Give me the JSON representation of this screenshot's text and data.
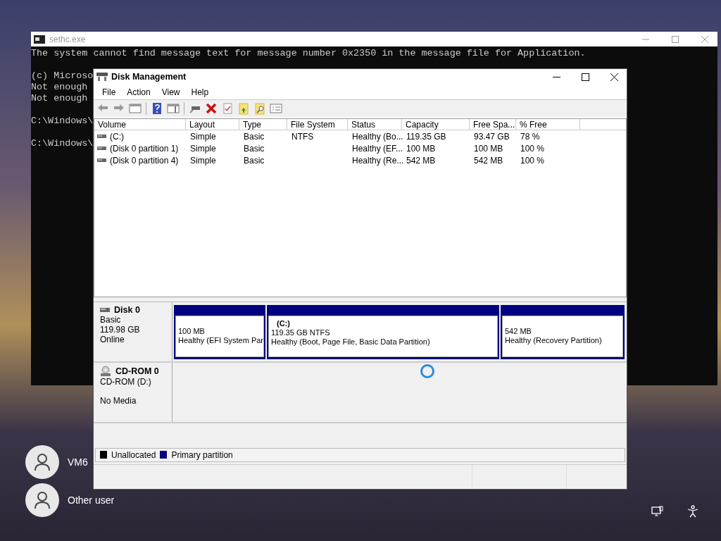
{
  "console": {
    "title": "sethc.exe",
    "paragraphs": [
      [
        "The system cannot find message text for message number 0x2350 in the message file for Application."
      ],
      [
        "(c) Microso",
        "Not enough",
        "Not enough"
      ],
      [
        "C:\\Windows\\"
      ],
      [
        "C:\\Windows\\"
      ]
    ]
  },
  "disk_management": {
    "title": "Disk Management",
    "menu": [
      "File",
      "Action",
      "View",
      "Help"
    ],
    "columns": [
      "Volume",
      "Layout",
      "Type",
      "File System",
      "Status",
      "Capacity",
      "Free Spa...",
      "% Free"
    ],
    "rows": [
      [
        "(C:)",
        "Simple",
        "Basic",
        "NTFS",
        "Healthy (Bo...",
        "119.35 GB",
        "93.47 GB",
        "78 %"
      ],
      [
        "(Disk 0 partition 1)",
        "Simple",
        "Basic",
        "",
        "Healthy (EF...",
        "100 MB",
        "100 MB",
        "100 %"
      ],
      [
        "(Disk 0 partition 4)",
        "Simple",
        "Basic",
        "",
        "Healthy (Re...",
        "542 MB",
        "542 MB",
        "100 %"
      ]
    ],
    "disks": [
      {
        "kind": "disk",
        "name": "Disk 0",
        "details": [
          "Basic",
          "119.98 GB",
          "Online"
        ],
        "partitions": [
          {
            "size": "100 MB",
            "status": "Healthy (EFI System Par"
          },
          {
            "title": "(C:)",
            "size": "119.35 GB NTFS",
            "status": "Healthy (Boot, Page File, Basic Data Partition)"
          },
          {
            "size": "542 MB",
            "status": "Healthy (Recovery Partition)"
          }
        ]
      },
      {
        "kind": "cdrom",
        "name": "CD-ROM 0",
        "details": [
          "CD-ROM (D:)"
        ],
        "note": "No Media"
      }
    ],
    "legend": [
      {
        "label": "Unallocated",
        "color": "#000000"
      },
      {
        "label": "Primary partition",
        "color": "#000080"
      }
    ]
  },
  "users": [
    {
      "name": "VM6"
    },
    {
      "name": "Other user"
    }
  ]
}
